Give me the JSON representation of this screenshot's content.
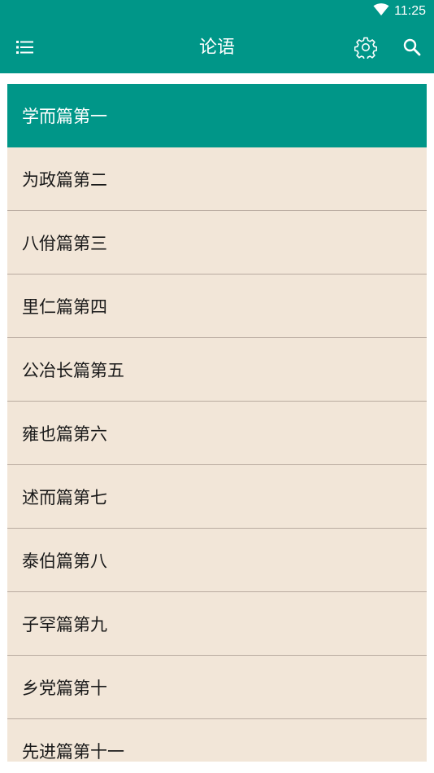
{
  "status": {
    "time": "11:25"
  },
  "toolbar": {
    "title": "论语",
    "menu_icon": "list-icon",
    "settings_icon": "gear-icon",
    "search_icon": "search-icon"
  },
  "colors": {
    "primary": "#009688",
    "list_bg": "#f2e6d8",
    "divider": "#b9aba0"
  },
  "chapters": [
    {
      "label": "学而篇第一",
      "selected": true
    },
    {
      "label": "为政篇第二"
    },
    {
      "label": "八佾篇第三"
    },
    {
      "label": "里仁篇第四"
    },
    {
      "label": "公冶长篇第五"
    },
    {
      "label": "雍也篇第六"
    },
    {
      "label": "述而篇第七"
    },
    {
      "label": "泰伯篇第八"
    },
    {
      "label": "子罕篇第九"
    },
    {
      "label": "乡党篇第十"
    },
    {
      "label": "先进篇第十一"
    }
  ]
}
